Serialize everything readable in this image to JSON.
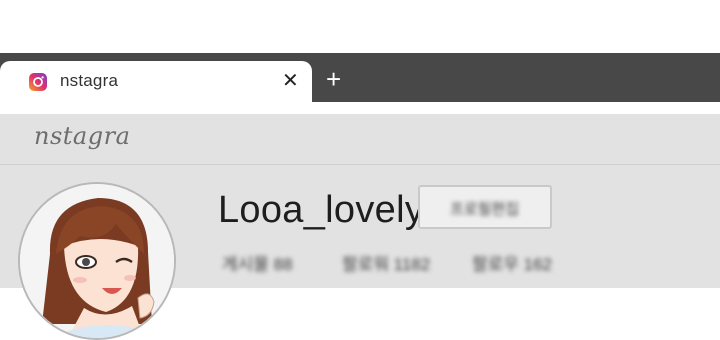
{
  "browser": {
    "tab": {
      "title": "nstagra",
      "close_symbol": "✕",
      "favicon": "instagram-icon"
    },
    "new_tab_symbol": "+"
  },
  "site": {
    "logo": "nstagra"
  },
  "profile": {
    "username": "Looa_lovely",
    "follow_button_label": "프로필편집",
    "stats": {
      "posts": "게시물 88",
      "followers": "팔로워 1182",
      "following": "팔로우 162"
    }
  },
  "colors": {
    "tab_bar": "#484848",
    "page_background": "#e2e2e2"
  }
}
